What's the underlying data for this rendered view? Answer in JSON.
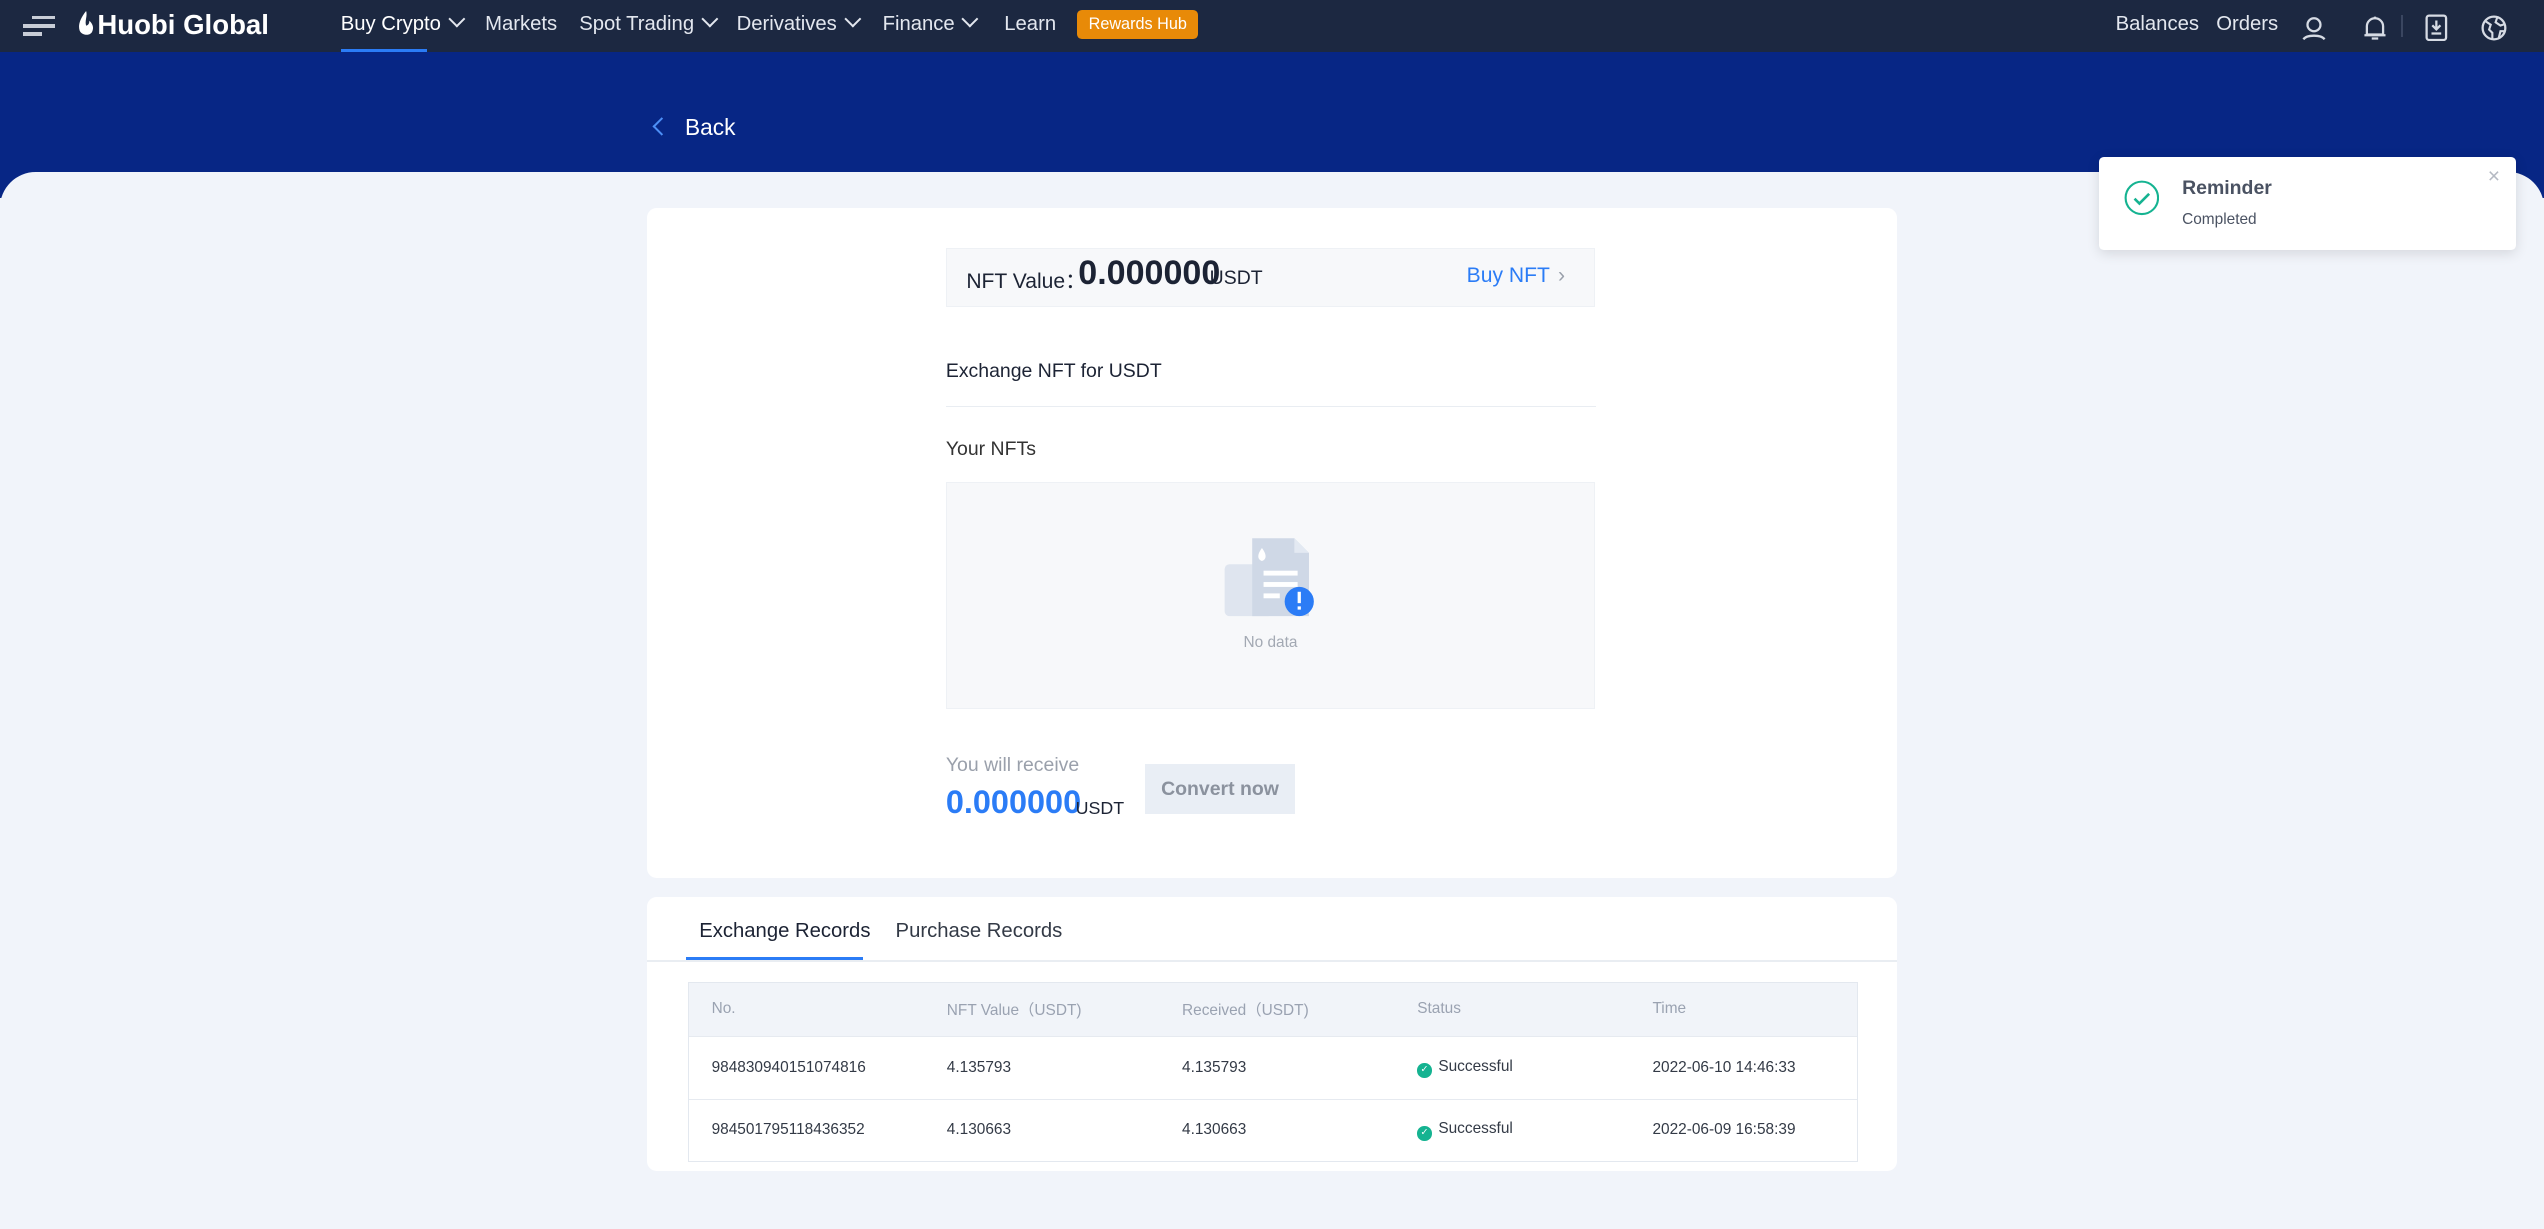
{
  "nav": {
    "logo": "Huobi Global",
    "logo_brand": "Huobi",
    "logo_suffix": "bi Global",
    "items": [
      {
        "label": "Buy Crypto"
      },
      {
        "label": "Markets"
      },
      {
        "label": "Spot Trading"
      },
      {
        "label": "Derivatives"
      },
      {
        "label": "Finance"
      },
      {
        "label": "Learn"
      }
    ],
    "rewards": "Rewards Hub",
    "balances": "Balances",
    "orders": "Orders"
  },
  "back": "Back",
  "nft_value": {
    "label": "NFT Value：",
    "value": "0.000000",
    "unit": "USDT",
    "buy": "Buy NFT"
  },
  "exchange_title": "Exchange NFT for USDT",
  "your_nfts": "Your NFTs",
  "empty": "No data",
  "receive": {
    "label": "You will receive",
    "value": "0.000000",
    "unit": "USDT",
    "button": "Convert now"
  },
  "records": {
    "tabs": [
      "Exchange Records",
      "Purchase Records"
    ],
    "columns": [
      "No.",
      "NFT Value（USDT)",
      "Received（USDT)",
      "Status",
      "Time"
    ],
    "rows": [
      [
        "984830940151074816",
        "4.135793",
        "4.135793",
        "Successful",
        "2022-06-10 14:46:33"
      ],
      [
        "984501795118436352",
        "4.130663",
        "4.130663",
        "Successful",
        "2022-06-09 16:58:39"
      ]
    ]
  },
  "toast": {
    "title": "Reminder",
    "message": "Completed"
  },
  "colors": {
    "nav": "#1c2841",
    "band": "#072685",
    "accent": "#2b7cf6",
    "success": "#15b391",
    "rewards": "#e88a08"
  }
}
